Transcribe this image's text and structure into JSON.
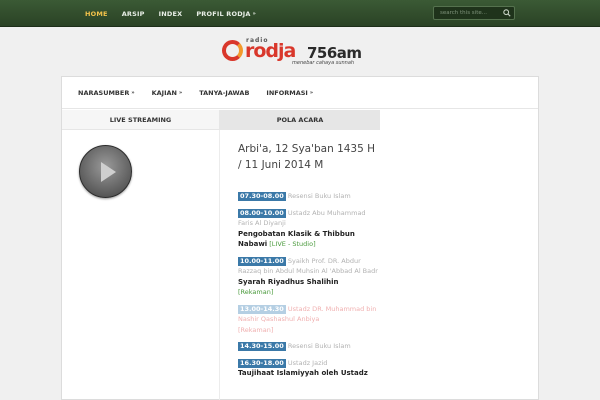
{
  "topnav": {
    "items": [
      {
        "label": "HOME",
        "active": true
      },
      {
        "label": "ARSIP"
      },
      {
        "label": "INDEX"
      },
      {
        "label": "PROFIL RODJA",
        "arrow": "»"
      }
    ],
    "search_placeholder": "search this site..."
  },
  "logo": {
    "radio": "radio",
    "rodja": "rodja",
    "freq": "756am",
    "tagline": "menebar cahaya sunnah"
  },
  "subnav": {
    "items": [
      {
        "label": "NARASUMBER",
        "arrow": "»"
      },
      {
        "label": "KAJIAN",
        "arrow": "»"
      },
      {
        "label": "TANYA-JAWAB",
        "arrow": ""
      },
      {
        "label": "INFORMASI",
        "arrow": "»"
      }
    ]
  },
  "tabs": {
    "live": "LIVE STREAMING",
    "pola": "POLA ACARA"
  },
  "schedule": {
    "date": "Arbi'a, 12 Sya'ban 1435 H / 11 Juni 2014 M",
    "entries": [
      {
        "time": "07.30-08.00",
        "speaker": "Resensi Buku Islam",
        "title": "",
        "note": ""
      },
      {
        "time": "08.00-10.00",
        "speaker": "Ustadz Abu Muhammad Faris Al Diyanji",
        "title": "Pengobatan Klasik & Thibbun Nabawi",
        "note": "[LIVE - Studio]"
      },
      {
        "time": "10.00-11.00",
        "speaker": "Syaikh Prof. DR. Abdur Razzaq bin Abdul Muhsin Al 'Abbad Al Badr",
        "title": "Syarah Riyadhus Shalihin",
        "note": "[Rekaman]"
      },
      {
        "time": "13.00-14.30",
        "speaker": "Ustadz DR. Muhammad bin Nashir",
        "title": "Qashashul Anbiya",
        "note": "[Rekaman]"
      },
      {
        "time": "14.30-15.00",
        "speaker": "Resensi Buku Islam",
        "title": "",
        "note": ""
      },
      {
        "time": "16.30-18.00",
        "speaker": "Ustadz Jazid",
        "title": "Taujihaat Islamiyyah oleh Ustadz",
        "note": ""
      }
    ]
  }
}
